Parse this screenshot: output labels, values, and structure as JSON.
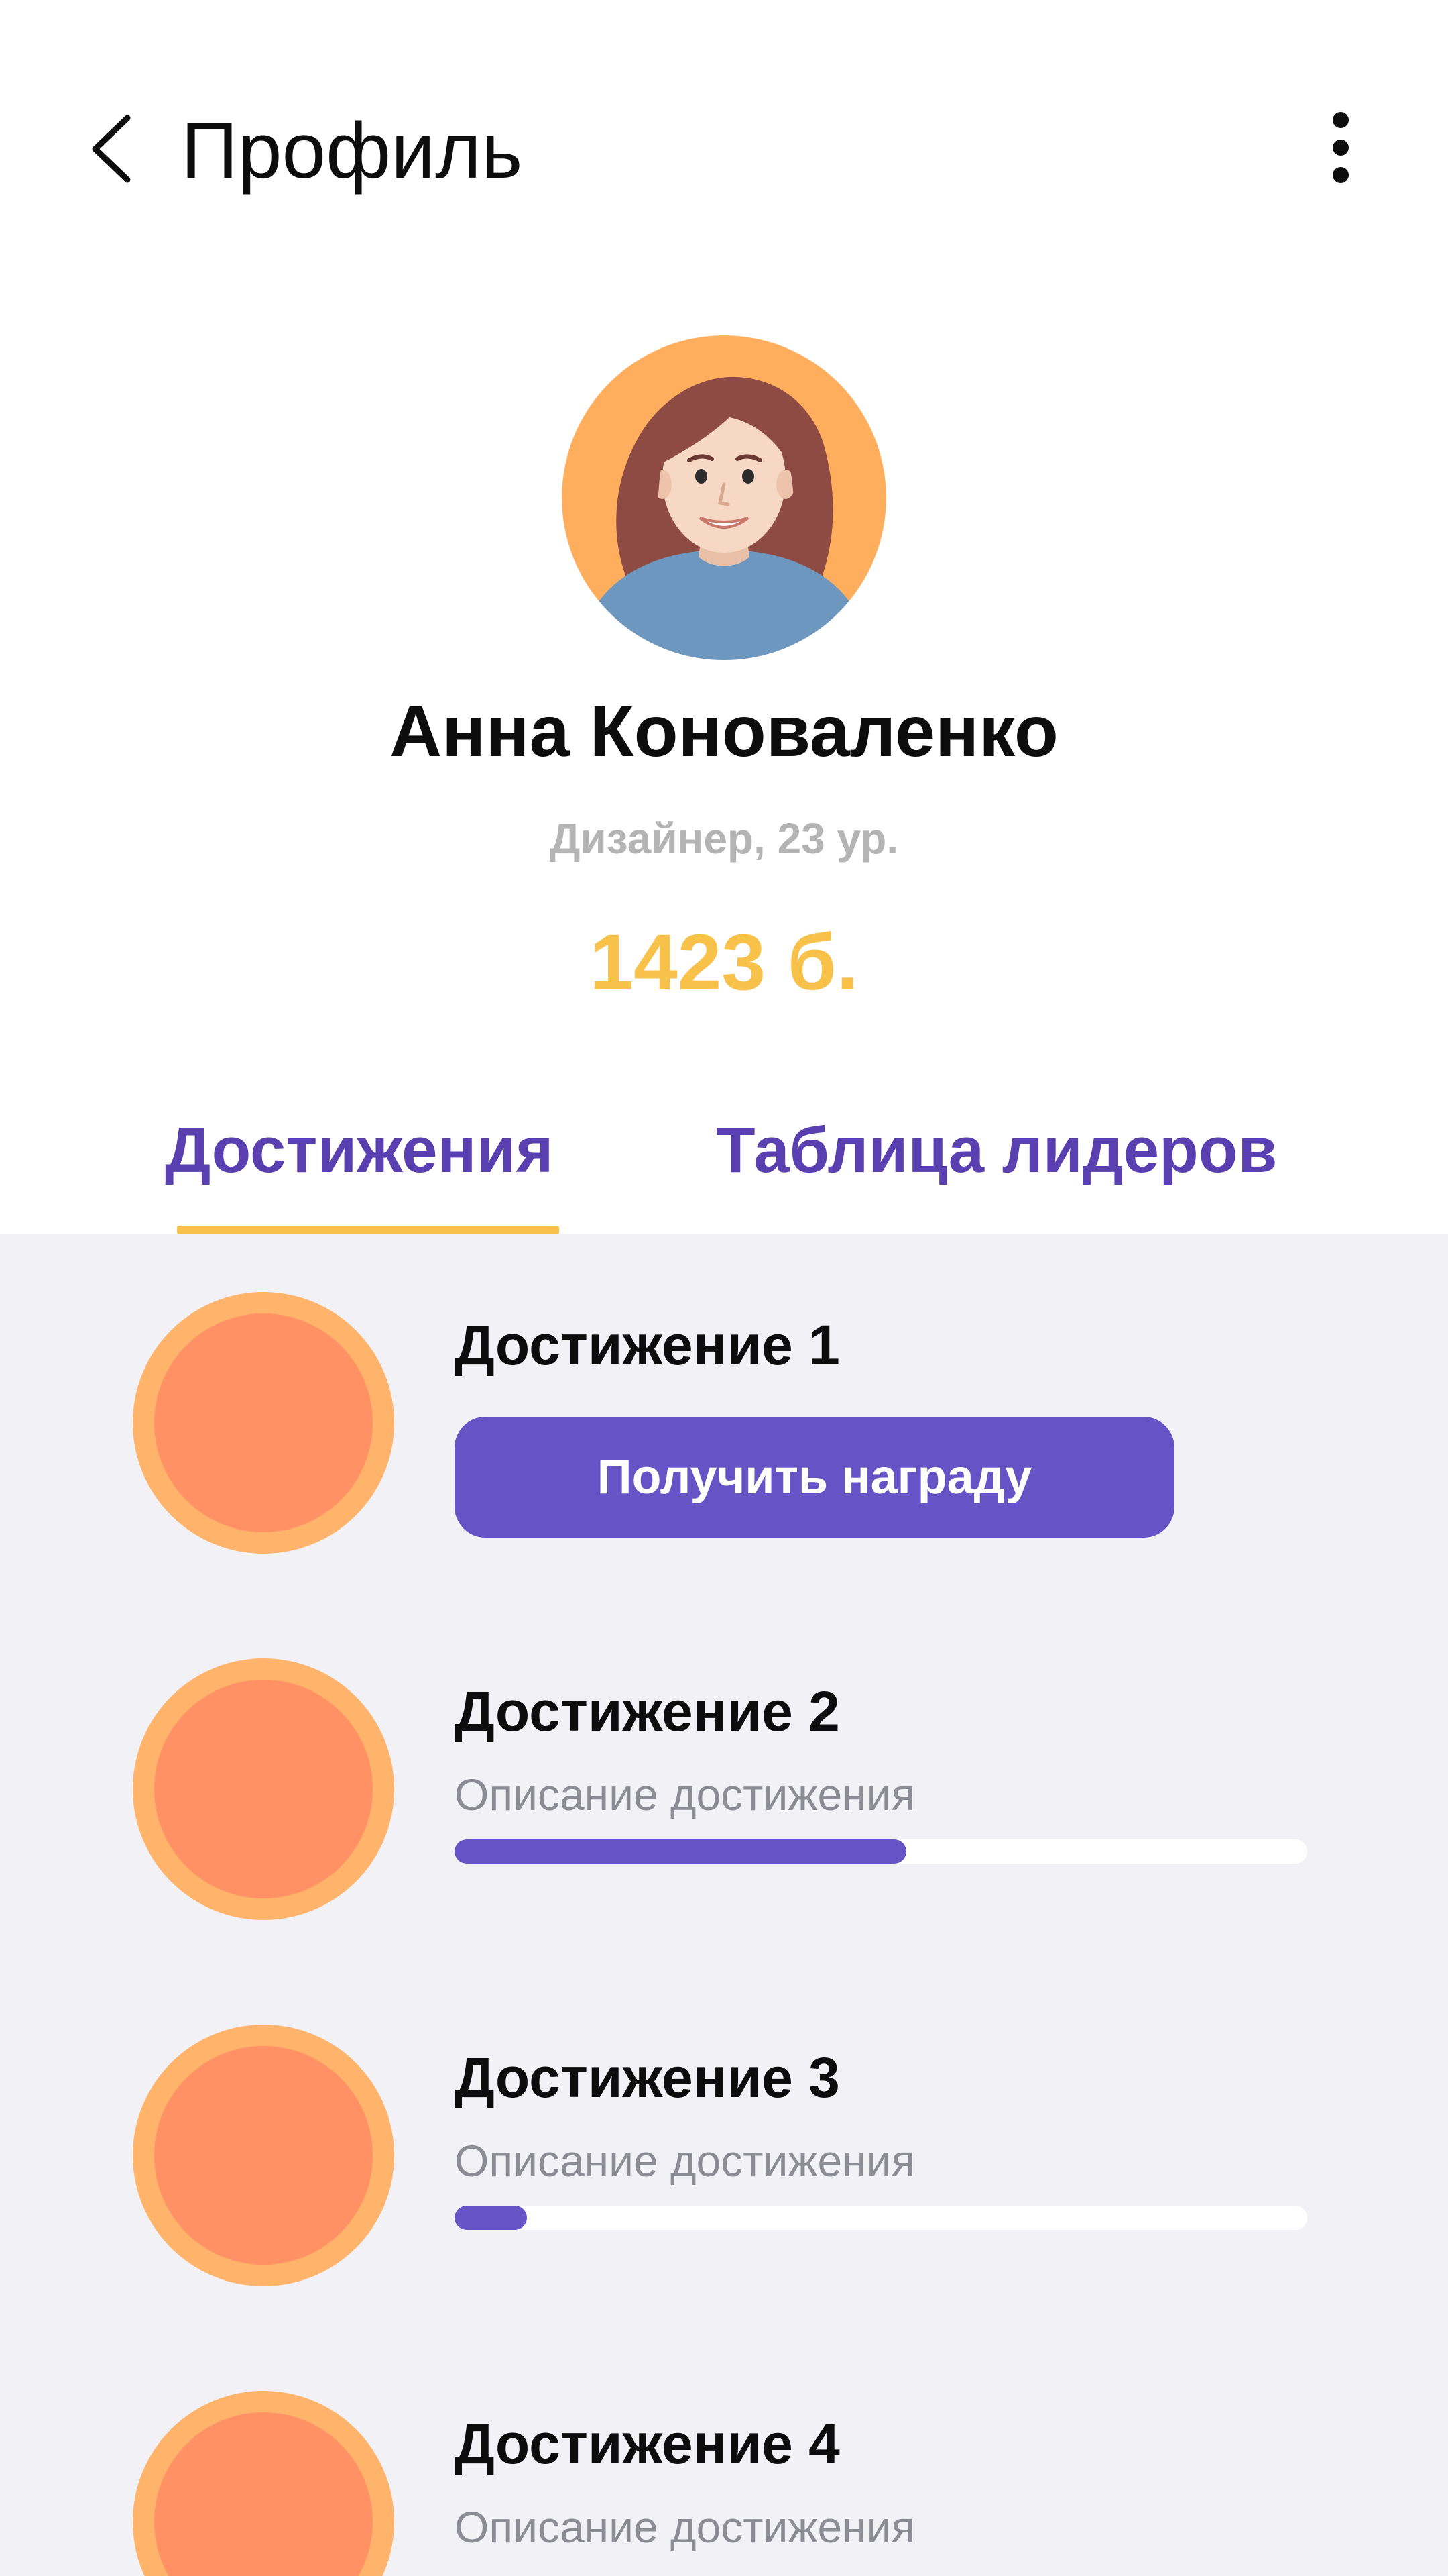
{
  "header": {
    "title": "Профиль",
    "back_icon": "chevron-left-icon",
    "menu_icon": "more-vertical-icon"
  },
  "profile": {
    "avatar": "woman-avatar-illustration",
    "name": "Анна Коноваленко",
    "meta": "Дизайнер, 23 ур.",
    "points": "1423 б."
  },
  "tabs": [
    {
      "label": "Достижения",
      "active": true
    },
    {
      "label": "Таблица лидеров",
      "active": false
    }
  ],
  "achievements": [
    {
      "title": "Достижение 1",
      "button_label": "Получить награду"
    },
    {
      "title": "Достижение 2",
      "description": "Описание достижения",
      "progress": 0.53
    },
    {
      "title": "Достижение 3",
      "description": "Описание достижения",
      "progress": 0.085
    },
    {
      "title": "Достижение 4",
      "description": "Описание достижения"
    }
  ],
  "colors": {
    "accent": "#6654C6",
    "tab_text": "#5A3FB0",
    "points": "#F8C14A",
    "badge_outer": "#FFB36B",
    "badge_inner": "#FF9164",
    "list_background": "#F1F1F6"
  }
}
